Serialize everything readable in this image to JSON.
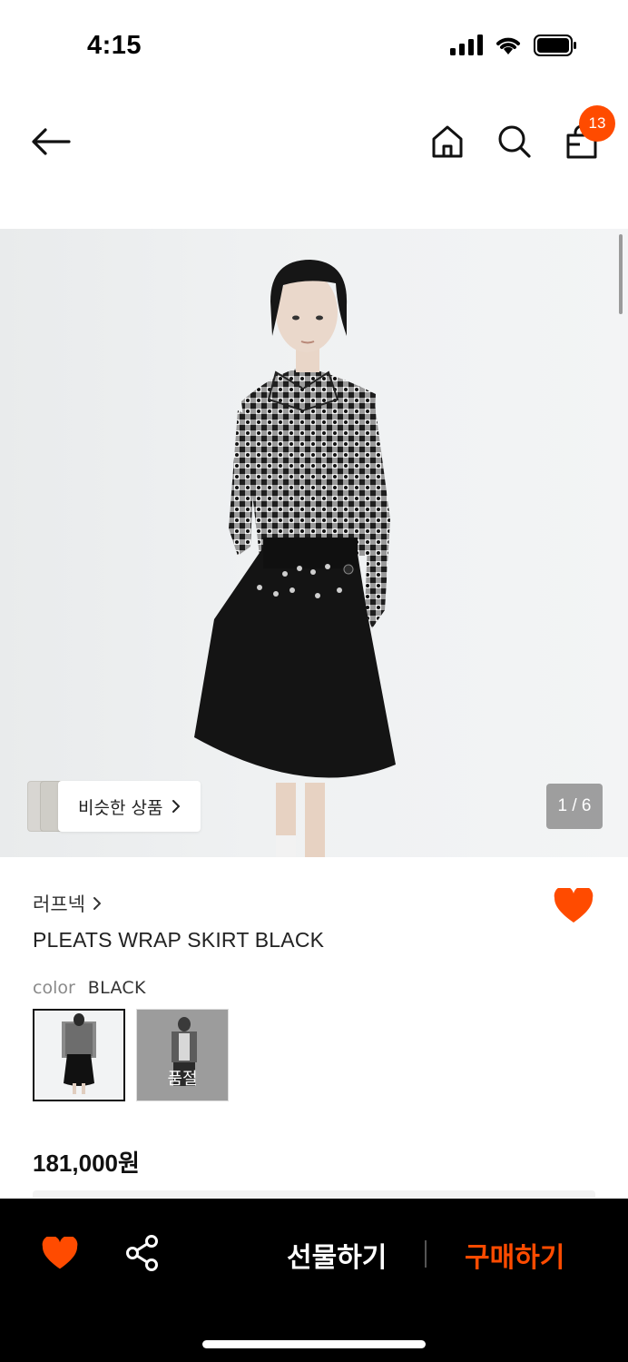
{
  "status_bar": {
    "time": "4:15"
  },
  "nav": {
    "cart_count": "13"
  },
  "product": {
    "similar_label": "비슷한 상품",
    "image_counter": "1 / 6",
    "brand": "러프넥",
    "name": "PLEATS WRAP SKIRT BLACK",
    "color_label": "color",
    "color_value": "BLACK",
    "swatches": [
      {
        "state": "selected"
      },
      {
        "state": "soldout",
        "label": "품절"
      }
    ],
    "price": "181,000원",
    "liked": true
  },
  "bottom_bar": {
    "gift_label": "선물하기",
    "buy_label": "구매하기"
  },
  "colors": {
    "accent": "#ff4b00",
    "bottom_bar_bg": "#000000",
    "text_primary": "#111111"
  },
  "icons": [
    "back-arrow-icon",
    "home-icon",
    "search-icon",
    "shopping-bag-icon",
    "heart-icon",
    "share-icon",
    "chevron-right-icon"
  ]
}
